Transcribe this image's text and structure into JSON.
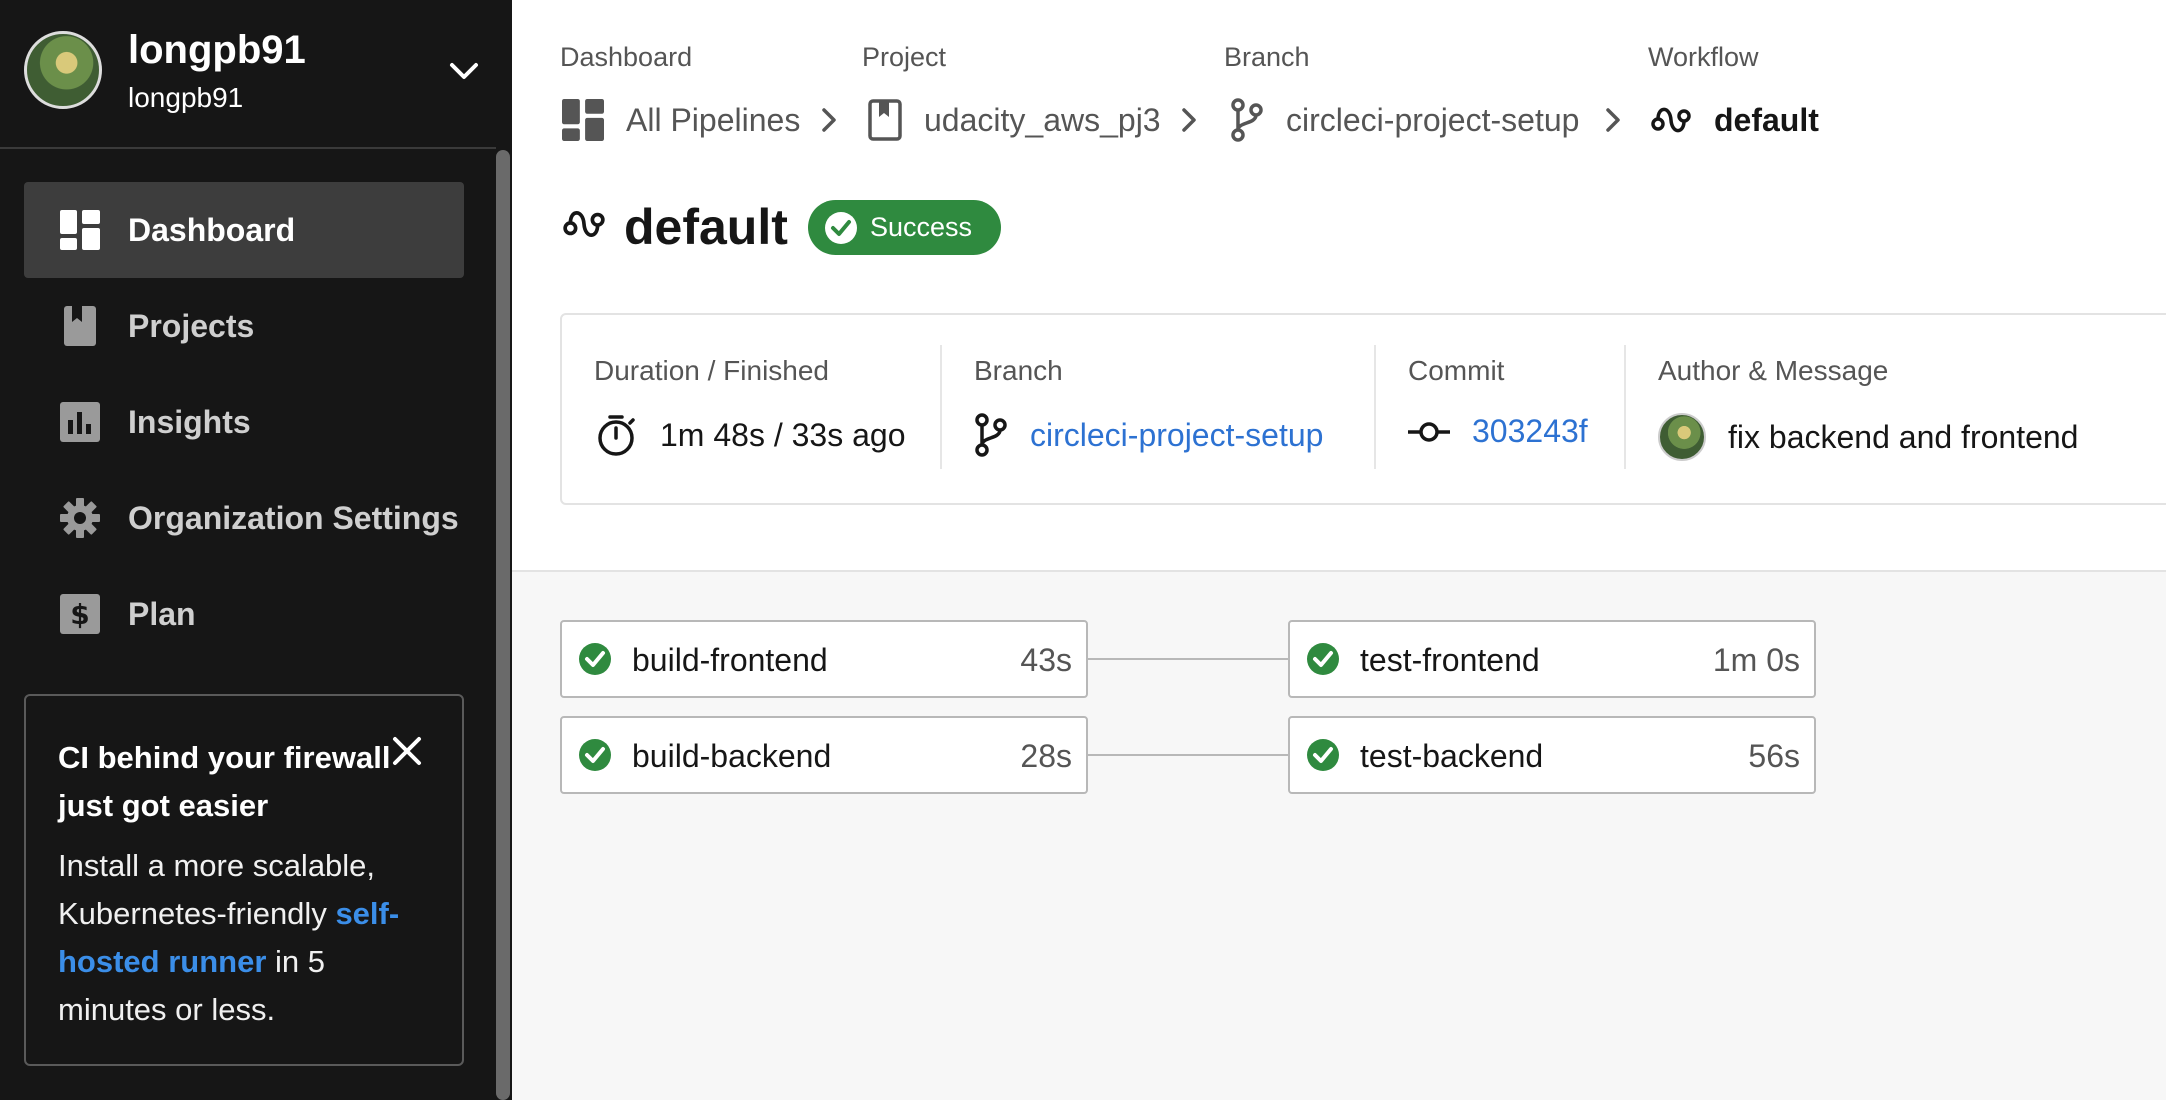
{
  "user": {
    "name": "longpb91",
    "handle": "longpb91"
  },
  "nav": [
    {
      "label": "Dashboard",
      "icon": "dashboard-icon",
      "active": true
    },
    {
      "label": "Projects",
      "icon": "book-icon",
      "active": false
    },
    {
      "label": "Insights",
      "icon": "bar-chart-icon",
      "active": false
    },
    {
      "label": "Organization Settings",
      "icon": "gear-icon",
      "active": false
    },
    {
      "label": "Plan",
      "icon": "dollar-icon",
      "active": false
    }
  ],
  "promo": {
    "title": "CI behind your firewall just got easier",
    "body_before": "Install a more scalable, Kubernetes-friendly ",
    "link": "self-hosted runner",
    "body_after": " in 5 minutes or less."
  },
  "breadcrumb": {
    "dashboard": {
      "caption": "Dashboard",
      "label": "All Pipelines"
    },
    "project": {
      "caption": "Project",
      "label": "udacity_aws_pj3"
    },
    "branch": {
      "caption": "Branch",
      "label": "circleci-project-setup"
    },
    "workflow": {
      "caption": "Workflow",
      "label": "default"
    }
  },
  "workflow": {
    "title": "default",
    "status": "Success",
    "status_color": "#2f8a3f"
  },
  "info": {
    "duration": {
      "caption": "Duration / Finished",
      "value": "1m 48s / 33s ago"
    },
    "branch": {
      "caption": "Branch",
      "value": "circleci-project-setup"
    },
    "commit": {
      "caption": "Commit",
      "value": "303243f"
    },
    "author": {
      "caption": "Author & Message",
      "value": "fix backend and frontend"
    }
  },
  "jobs": [
    {
      "name": "build-frontend",
      "duration": "43s"
    },
    {
      "name": "build-backend",
      "duration": "28s"
    },
    {
      "name": "test-frontend",
      "duration": "1m 0s"
    },
    {
      "name": "test-backend",
      "duration": "56s"
    }
  ],
  "colors": {
    "sidebar_bg": "#161616",
    "link": "#2d72d2",
    "success": "#2f8a3f"
  }
}
